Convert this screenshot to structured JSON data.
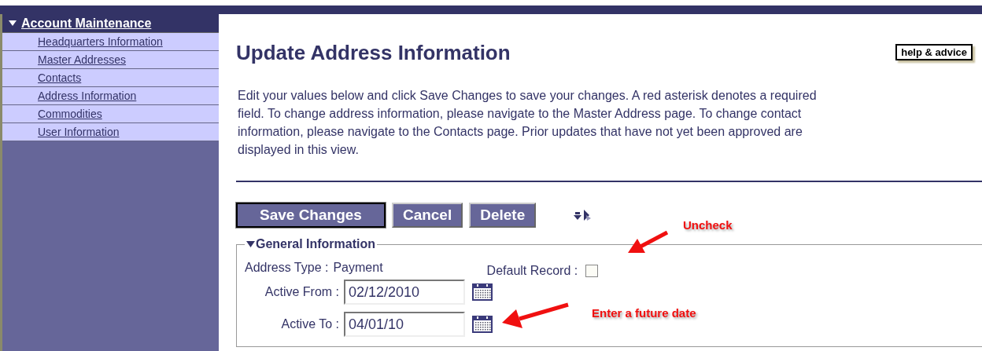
{
  "sidebar": {
    "header": {
      "label": "Account Maintenance",
      "expanded": true
    },
    "items": [
      {
        "label": "Headquarters Information"
      },
      {
        "label": "Master Addresses"
      },
      {
        "label": "Contacts"
      },
      {
        "label": "Address Information"
      },
      {
        "label": "Commodities"
      },
      {
        "label": "User Information"
      }
    ]
  },
  "page": {
    "title": "Update Address Information",
    "help_button": "help & advice",
    "intro": "Edit your values below and click Save Changes to save your changes. A red asterisk denotes a required field. To change address information, please navigate to the Master Address page. To change contact information, please navigate to the Contacts page. Prior updates that have not yet been approved are displayed in this view.",
    "buttons": [
      {
        "label": "Save Changes",
        "selected": true
      },
      {
        "label": "Cancel",
        "selected": false
      },
      {
        "label": "Delete",
        "selected": false
      }
    ],
    "section": {
      "legend": "General Information",
      "expanded": true,
      "address_type": {
        "label": "Address Type :",
        "value": "Payment"
      },
      "default_record": {
        "label": "Default Record :",
        "checked": false
      },
      "active_from": {
        "label": "Active From :",
        "value": "02/12/2010"
      },
      "active_to": {
        "label": "Active To :",
        "value": "04/01/10"
      }
    }
  },
  "annotations": [
    {
      "text": "Uncheck"
    },
    {
      "text": "Enter a future date"
    }
  ]
}
